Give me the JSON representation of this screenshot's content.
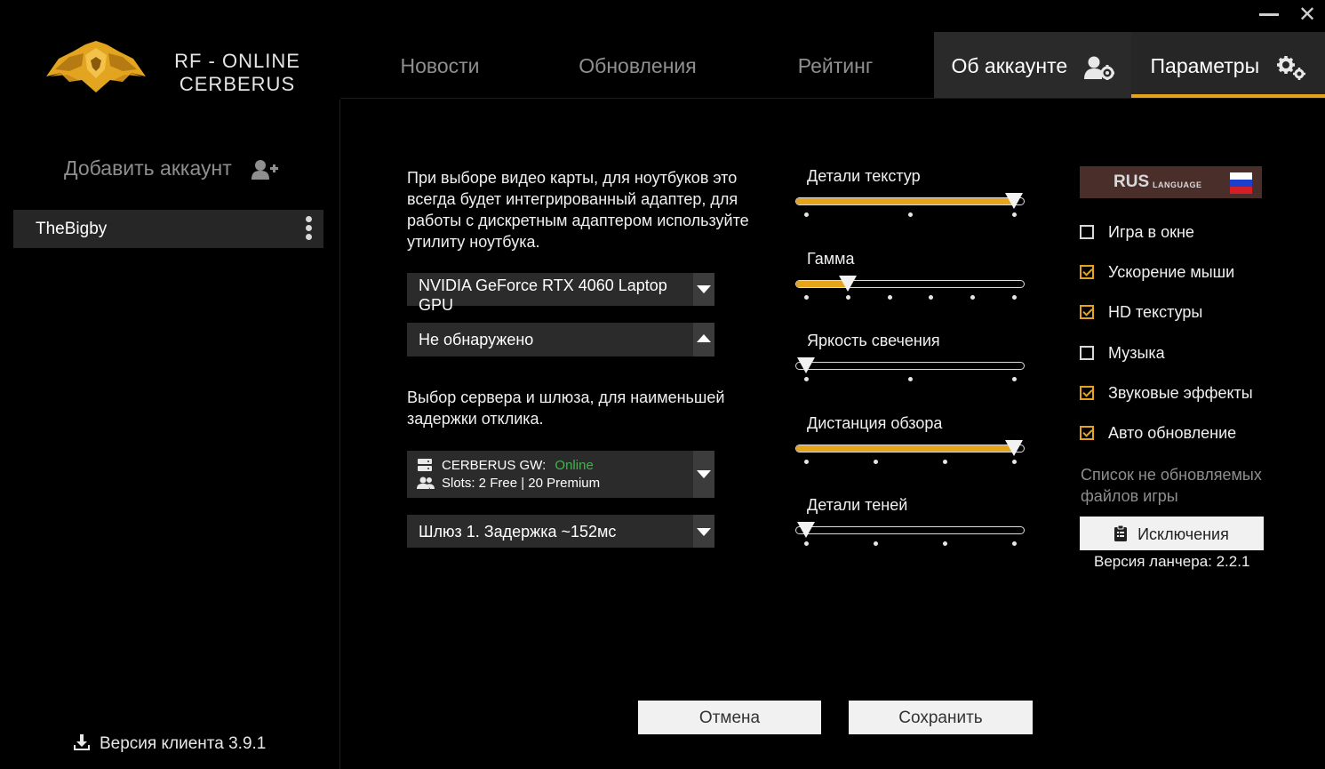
{
  "window": {
    "minimize_icon": "minimize-icon",
    "close_icon": "close-icon",
    "close_glyph": "✕"
  },
  "logo": {
    "line1": "RF - ONLINE",
    "line2": "CERBERUS"
  },
  "nav": {
    "tabs": [
      {
        "label": "Новости"
      },
      {
        "label": "Обновления"
      },
      {
        "label": "Рейтинг"
      },
      {
        "label": "Об аккаунте",
        "icon": "user-settings-icon"
      },
      {
        "label": "Параметры",
        "icon": "gears-icon"
      }
    ],
    "active": "Параметры",
    "accent_color": "#e5a41c"
  },
  "sidebar": {
    "add_account_label": "Добавить аккаунт",
    "add_account_icon": "user-plus-icon",
    "accounts": [
      {
        "name": "TheBigby"
      }
    ],
    "client_version": "Версия клиента 3.9.1",
    "client_version_icon": "download-icon"
  },
  "gpu": {
    "description": "При выборе видео карты, для ноутбуков это всегда будет интегрированный адаптер, для работы с дискретным адаптером используйте утилиту ноутбука.",
    "primary_selected": "NVIDIA GeForce RTX 4060 Laptop GPU",
    "secondary_selected": "Не обнаружено"
  },
  "server": {
    "description": "Выбор сервера и шлюза, для наименьшей задержки отклика.",
    "gateway_label": "CERBERUS GW:",
    "gateway_status": "Online",
    "slots_text": "Slots: 2 Free | 20 Premium",
    "gateway_icon": "server-icon",
    "slots_icon": "users-icon",
    "gate_selected": "Шлюз 1. Задержка ~152мс"
  },
  "sliders": [
    {
      "label": "Детали текстур",
      "steps": 3,
      "value": 2
    },
    {
      "label": "Гамма",
      "steps": 6,
      "value": 1
    },
    {
      "label": "Яркость свечения",
      "steps": 3,
      "value": 0
    },
    {
      "label": "Дистанция обзора",
      "steps": 4,
      "value": 3
    },
    {
      "label": "Детали теней",
      "steps": 4,
      "value": 0
    }
  ],
  "language": {
    "code": "RUS",
    "caption": "LANGUAGE",
    "flag_colors": [
      "#ffffff",
      "#1c3fd0",
      "#d51f26"
    ]
  },
  "options": [
    {
      "label": "Игра в окне",
      "checked": false
    },
    {
      "label": "Ускорение мыши",
      "checked": true
    },
    {
      "label": "HD текстуры",
      "checked": true
    },
    {
      "label": "Музыка",
      "checked": false
    },
    {
      "label": "Звуковые эффекты",
      "checked": true
    },
    {
      "label": "Авто обновление",
      "checked": true
    }
  ],
  "exclusions": {
    "note": "Список не обновляемых файлов игры",
    "button_label": "Исключения",
    "button_icon": "clipboard-icon"
  },
  "launcher_version": "Версия ланчера: 2.2.1",
  "footer": {
    "cancel_label": "Отмена",
    "save_label": "Сохранить"
  }
}
